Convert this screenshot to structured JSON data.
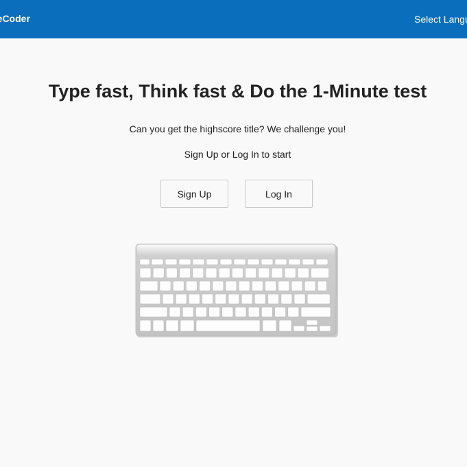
{
  "navbar": {
    "brand": "teCoder",
    "language_label": "Select Langu"
  },
  "hero": {
    "headline": "Type fast, Think fast & Do the 1-Minute test",
    "tagline": "Can you get the highscore title? We challenge you!",
    "prompt": "Sign Up or Log In to start"
  },
  "actions": {
    "signup_label": "Sign Up",
    "login_label": "Log In"
  },
  "colors": {
    "navbar": "#0a6ebd",
    "background": "#f9f9f9",
    "text": "#222222"
  },
  "icons": {
    "keyboard": "keyboard-illustration"
  }
}
